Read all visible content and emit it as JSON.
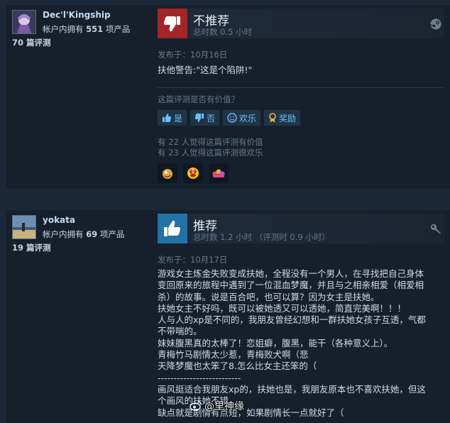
{
  "reviews": [
    {
      "user": {
        "name": "Dec'l'Kingship",
        "products_prefix": "帐户内拥有",
        "products_count": "551",
        "products_suffix": "项产品",
        "reviews_count": "70 篇评测"
      },
      "recommendation": "不推荐",
      "hours": "总时数 0.5 小时",
      "posted": "发布于：10月16日",
      "text": "扶他警告:\"这是个陷阱!\"",
      "helpful_question": "这篇评测是否有价值？",
      "buttons": {
        "yes": "是",
        "no": "否",
        "funny": "欢乐",
        "award": "奖励"
      },
      "helpful_count": "有 22 人觉得这篇评测有价值",
      "funny_count": "有 23 人觉得这篇评测很欢乐",
      "awards": [
        "award-icon-1",
        "award-icon-2",
        "award-icon-3"
      ],
      "icon": "steam-icon"
    },
    {
      "user": {
        "name": "yokata",
        "products_prefix": "帐户内拥有",
        "products_count": "69",
        "products_suffix": "项产品",
        "reviews_count": "19 篇评测"
      },
      "recommendation": "推荐",
      "hours": "总时数 1.2 小时 （评测时 0.9 小时）",
      "posted": "发布于：10月17日",
      "text_lines": [
        "游戏女主炼金失败变成扶她，全程没有一个男人，在寻找把自己身体",
        "变回原来的旅程中遇到了一位混血梦魔，并且与之相亲相爱（相爱相",
        "杀）的故事。说是百合吧，也可以算？因为女主是扶她。",
        "扶她女主不好吗，既可以被她透又可以透她，简直完美啊！！！",
        "人与人的xp是不同的，我朋友曾经幻想和一群扶她女孩子互透，气都",
        "不带喘的。",
        "妹妹腹黑真的太棒了！恋姐癖，腹黑，能干（各种意义上）。",
        "青梅竹马剧情太少惹，青梅败犬啊（悲",
        "天降梦魔也太笨了8.怎么比女主还笨的（",
        "--------------------------",
        "画风挺适合我朋友xp的，扶她也是，我朋友原本也不喜欢扶她，但这",
        "个画风的扶她不错。",
        "缺点就是剧情有点短，如果剧情长一点就好了（"
      ],
      "icon": "wrench-icon"
    }
  ],
  "watermark": "@里神缘"
}
